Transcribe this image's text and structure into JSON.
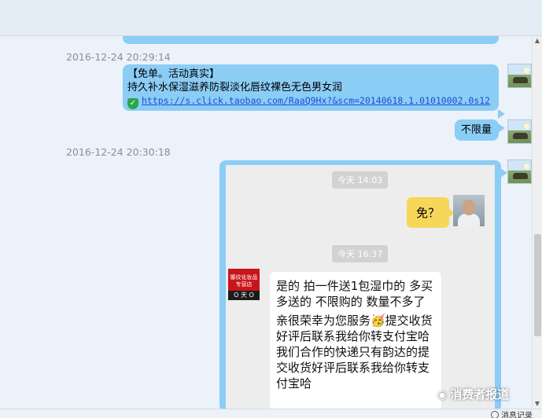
{
  "messages": [
    {
      "timestamp": "2016-12-24 20:29:14",
      "line1": "【免单。活动真实】",
      "line2": "持久补水保湿滋养防裂淡化唇纹裸色无色男女润",
      "link": "https://s.click.taobao.com/RaaQ9Hx?&scm=20140618.1.01010002.0s12"
    },
    {
      "text": "不限量"
    },
    {
      "timestamp": "2016-12-24 20:30:18"
    }
  ],
  "screenshot": {
    "time1": "今天 14:03",
    "question": "免？",
    "time2": "今天 16:37",
    "shop_name": "娜纹化妆品专营店",
    "shop_tag": "O 天 O",
    "reply1": "是的 拍一件送1包湿巾的 多买多送的 不限购的 数量不多了",
    "reply2": "亲很荣幸为您服务🥳提交收货好评后联系我给你转支付宝哈",
    "reply3": "我们合作的快递只有韵达的提交收货好评后联系我给你转支付宝哈"
  },
  "watermark": "消费者报道",
  "footer": {
    "history_label": "消息记录"
  },
  "colors": {
    "bubble": "#8bcdf5",
    "chat_bg": "#ecf2f9",
    "yellow_bubble": "#f7d75a"
  }
}
